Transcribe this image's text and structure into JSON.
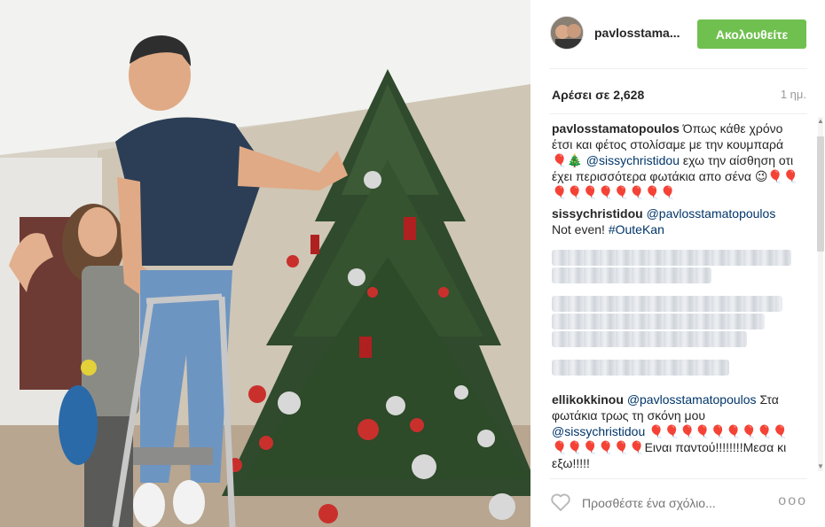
{
  "post": {
    "username": "pavlosstama...",
    "follow_label": "Ακολουθείτε",
    "likes_text": "Αρέσει σε 2,628",
    "time_text": "1 ημ.",
    "comments": [
      {
        "user": "pavlosstamatopoulos",
        "text_a": " Όπως κάθε χρόνο έτσι και φέτος στολίσαμε με την κουμπαρά 🎈🎄 ",
        "mention": "@sissychristidou",
        "text_b": " εχω την αίσθηση οτι έχει περισσότερα φωτάκια απο σένα 😉🎈🎈🎈🎈🎈🎈🎈🎈🎈🎈"
      },
      {
        "user": "sissychristidou",
        "mention": "@pavlosstamatopoulos",
        "text_a": " Not even! ",
        "hashtag": "#OuteKan"
      },
      {
        "user": "ellikokkinou",
        "mention": "@pavlosstamatopoulos",
        "text_a": " Στα φωτάκια τρως τη σκόνη μου ",
        "mention2": "@sissychristidou",
        "text_b": " 🎈🎈🎈🎈🎈🎈🎈🎈🎈🎈🎈🎈🎈🎈🎈Ειναι παντού!!!!!!!!Μεσα κι εξω!!!!!"
      }
    ],
    "partial_user": "a",
    "add_comment_placeholder": "Προσθέστε ένα σχόλιο...",
    "more_label": "ooo"
  },
  "colors": {
    "follow_bg": "#70c050",
    "link": "#003569",
    "muted": "#999999"
  },
  "icons": {
    "like": "heart-outline-icon",
    "options": "more-options-icon"
  }
}
